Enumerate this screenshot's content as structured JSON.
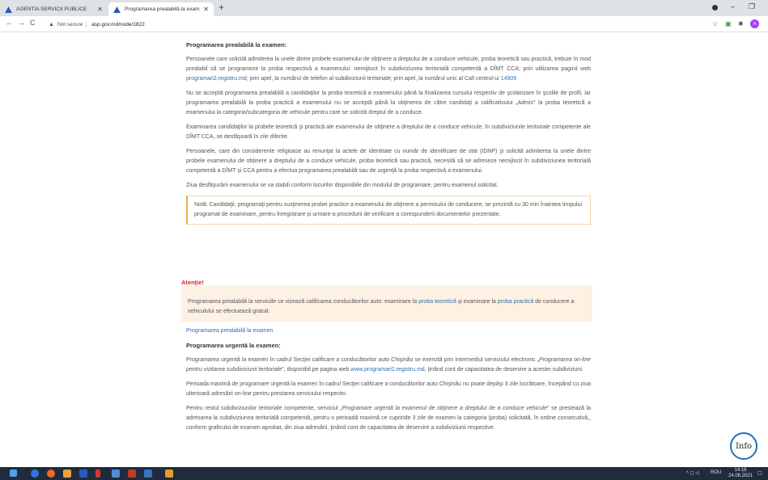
{
  "browser": {
    "tabs": [
      {
        "label": "AGENTIA SERVICII PUBLICE",
        "active": false
      },
      {
        "label": "Programarea prealabilă la exam",
        "active": true
      }
    ],
    "security_label": "Not secure",
    "url": "asp.gov.md/node/1822",
    "profile_initial": "A"
  },
  "section1": {
    "heading": "Programarea prealabilă la examen:",
    "p1": "Persoanele care solicită admiterea la unele dintre probele examenului de obţinere a dreptului de a conduce vehicule, proba teoretică sau practică, trebuie în mod prealabil să se programeze la proba respectivă a examenului: nemijlocit în subdiviziunea teritorială competentă a DÎMT CCA; prin utilizarea paginii web ",
    "p1_link": "programari2.registru.md",
    "p1_mid": "; prin apel, la numărul de telefon al subdiviziunii teritoriale; prin apel, la numărul unic al Call centrul-ui ",
    "p1_phone": "14909",
    "p2": "Nu se acceptă programarea prealabilă a candidaţilor la proba teoretică a examenului până la finalizarea cursului respectiv de şcolarizare în şcolile de profil, iar programarea prealabilă la proba practică a examenului nu se acceptă până la obţinerea de către candidaţi a calificativului „Admis\" la proba teoretică a examenului la categoria/subcategoria de vehicule pentru care se solicită dreptul de a conduce.",
    "p3": "Examinarea candidaţilor la probele teoretică şi practică ale examenului de obţinere a dreptului de a conduce vehicule, în subdiviziunile teritoriale competente ale DÎMT CCA, se desfăşoară în zile diferite.",
    "p4": "Persoanele, care din considerente religioase au renunţat la actele de identitate cu număr de identificare de stat (IDNP) şi solicită admiterea la unele dintre probele examenului de obţinere a dreptului de a conduce vehicule, proba teoretică sau practică, necesită să se adreseze nemijlocit în subdiviziunea teritorială competentă a DÎMT şi CCA pentru a efectua programarea prealabilă sau de urgenţă la proba respectivă a examenului.",
    "p5": "Ziua desfăşurării examenului se va stabili conform locurilor disponibile din modulul de programare, pentru examenul solicitat.",
    "note": "Notă: Candidaţii, programaţi pentru susţinerea probei practice a examenului de obţinere a permisului de conducere, se prezintă cu 30 min înaintea timpului programat de examinare, pentru înregistrare şi urmare-a procedurii de verificare a corespunderii documentelor prezentate."
  },
  "attention": {
    "title": "Atenţie!",
    "text_a": "Programarea prealabilă la serviciile ce vizează calificarea conducătorilor auto: examinare la ",
    "link1": "proba teoretică",
    "text_b": " şi examinare la ",
    "link2": "proba practică",
    "text_c": " de conducere a vehiculului se efectuează gratuit."
  },
  "section2": {
    "link": "Programarea prealabilă la examen",
    "heading": "Programarea urgentă la examen:",
    "p1_a": "Programarea urgentă la examen în cadrul Secţiei calificare a conducătorilor auto Chişinău se exercită prin intermediul serviciului electronic „",
    "p1_it": "Programarea on-line pentru vizitarea subdiviziunii teritoriale",
    "p1_b": "\", disponibil pe pagina web ",
    "p1_link": "www.programari2.registru.md",
    "p1_c": ", ţinând cont de capacitatea de deservire a acestei subdiviziuni.",
    "p2": "Perioada maximă de programare urgentă la examen în cadrul Secţiei calificare a conducătorilor auto Chişinău nu poate depăşi 3 zile lucrătoare, începând cu ziua ulterioară adresării on-line pentru prestarea serviciului respectiv.",
    "p3_a": "Pentru restul subdiviziunilor teritoriale competente, serviciul „",
    "p3_it": "Programare urgentă la examenul de obţinere a dreptului de a conduce vehicule",
    "p3_b": "\" se prestează la adresarea la subdiviziunea teritorială competentă, pentru o perioadă maximă ce cuprinde 3 zile de examen la categoria (proba) solicitată, în ordine consecutivă,, conform graficului de examen aprobat, din ziua adresării, ţinând cont de capacitatea de deservire a subdiviziunii respective."
  },
  "info_button": "Info",
  "taskbar": {
    "lang": "ROU",
    "time": "14:18",
    "date": "24.06.2021"
  },
  "colors": {
    "link": "#2f6eb5",
    "attention_title": "#c9302c",
    "attention_bg": "#fdf1e4",
    "note_border": "#f0ad4e",
    "taskbar": "#202b3d"
  }
}
